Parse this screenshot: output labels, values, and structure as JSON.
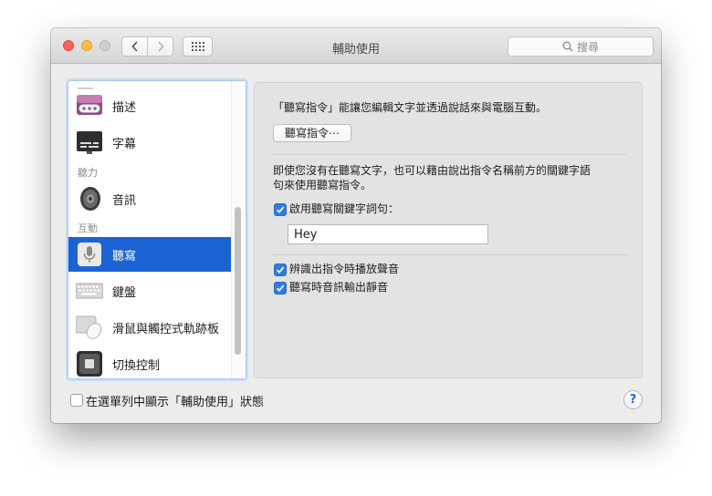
{
  "window": {
    "title": "輔助使用"
  },
  "search": {
    "placeholder": "搜尋"
  },
  "sidebar": {
    "items": [
      {
        "label": "描述",
        "icon": "speech-bubble-icon"
      },
      {
        "label": "字幕",
        "icon": "captions-icon"
      },
      {
        "label": "音訊",
        "icon": "speaker-icon"
      },
      {
        "label": "聽寫",
        "icon": "microphone-icon",
        "selected": true
      },
      {
        "label": "鍵盤",
        "icon": "keyboard-icon"
      },
      {
        "label": "滑鼠與觸控式軌跡板",
        "icon": "mouse-icon"
      },
      {
        "label": "切換控制",
        "icon": "switch-control-icon"
      }
    ],
    "headers": {
      "hearing": "聽力",
      "interaction": "互動"
    }
  },
  "main": {
    "intro": "「聽寫指令」能讓您編輯文字並透過說話來與電腦互動。",
    "commands_button": "聽寫指令⋯",
    "keyword_desc_line1": "即使您沒有在聽寫文字，也可以藉由說出指令名稱前方的關鍵字語",
    "keyword_desc_line2": "句來使用聽寫指令。",
    "enable_keyword_label": "啟用聽寫關鍵字詞句：",
    "keyword_value": "Hey",
    "play_sound_label": "辨識出指令時播放聲音",
    "mute_audio_label": "聽寫時音訊輸出靜音"
  },
  "footer": {
    "menubar_label": "在選單列中顯示「輔助使用」狀態",
    "help": "?"
  },
  "colors": {
    "accent": "#1b63d2",
    "checkbox": "#2f7de1"
  }
}
